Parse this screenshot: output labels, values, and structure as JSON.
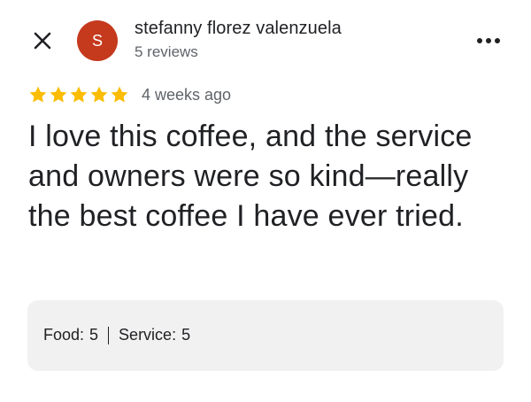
{
  "header": {
    "close_icon": "close-icon",
    "avatar_letter": "S",
    "avatar_color": "#c5391d",
    "reviewer_name": "stefanny florez valenzuela",
    "review_count": "5 reviews",
    "more_icon": "more-options-icon"
  },
  "review": {
    "rating": 5,
    "rating_max": 5,
    "star_color": "#fbbc04",
    "date": "4 weeks ago",
    "text": "I love this coffee, and the service and owners were so kind—really the best coffee I have ever tried."
  },
  "subratings": {
    "food_label": "Food:",
    "food_value": "5",
    "service_label": "Service:",
    "service_value": "5",
    "background": "#f1f1f1"
  }
}
